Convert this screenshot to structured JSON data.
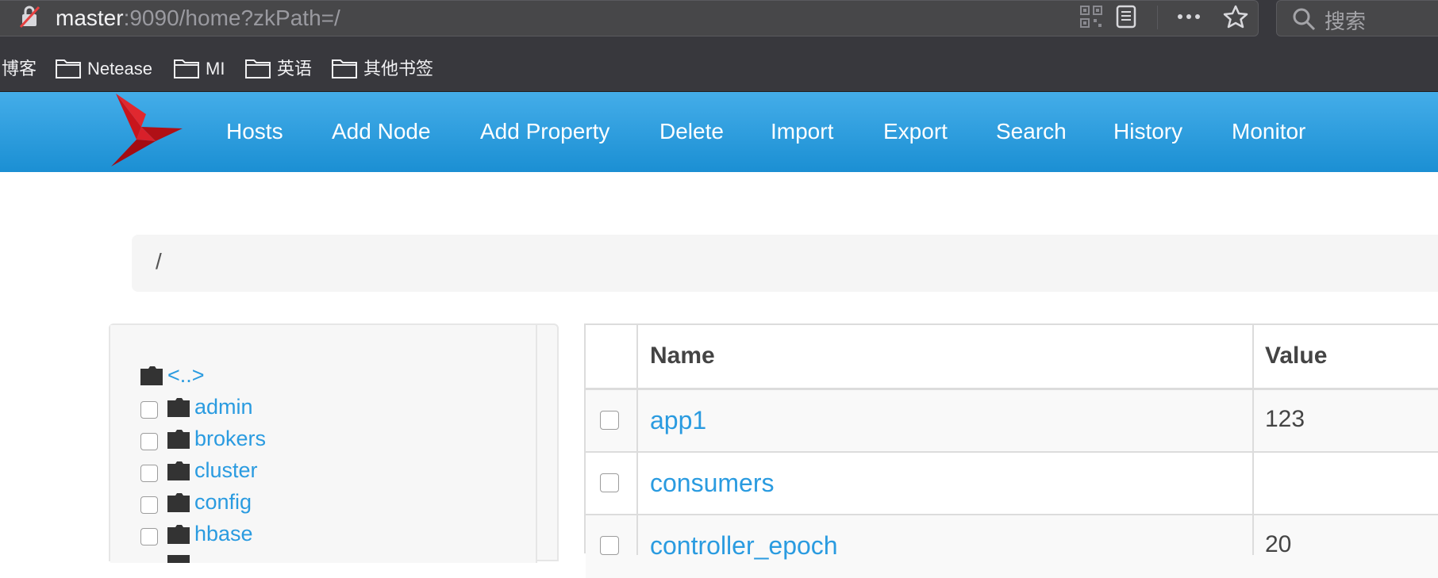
{
  "browser": {
    "url_host": "master",
    "url_rest": ":9090/home?zkPath=/",
    "search_placeholder": "搜索",
    "bookmarks": [
      "博客",
      "Netease",
      "MI",
      "英语",
      "其他书签"
    ]
  },
  "nav": {
    "items": [
      "Hosts",
      "Add Node",
      "Add Property",
      "Delete",
      "Import",
      "Export",
      "Search",
      "History",
      "Monitor"
    ]
  },
  "breadcrumb": "/",
  "tree": {
    "parent_link": "<..>",
    "items": [
      "admin",
      "brokers",
      "cluster",
      "config",
      "hbase"
    ]
  },
  "table": {
    "headers": {
      "name": "Name",
      "value": "Value"
    },
    "rows": [
      {
        "name": "app1",
        "value": "123"
      },
      {
        "name": "consumers",
        "value": ""
      },
      {
        "name": "controller_epoch",
        "value": "20"
      }
    ]
  },
  "colors": {
    "nav_top": "#44ade9",
    "nav_bottom": "#1b8fd3",
    "link": "#2a9be0",
    "logo": "#e0282f"
  }
}
